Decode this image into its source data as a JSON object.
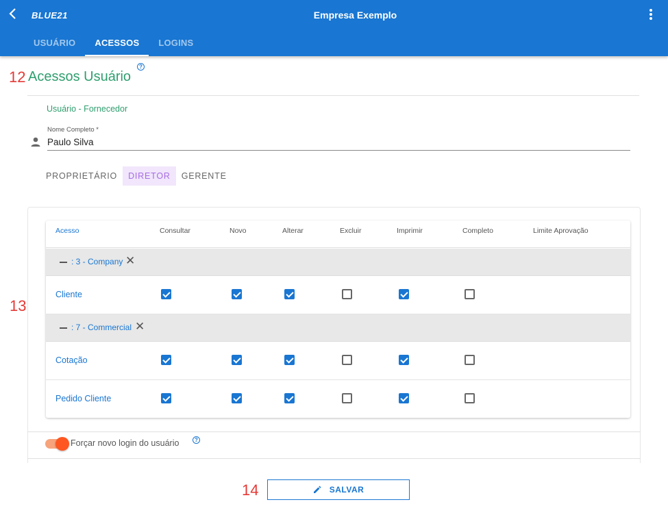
{
  "appbar": {
    "brand": "BLUE21",
    "title": "Empresa Exemplo",
    "tabs": [
      {
        "label": "USUÁRIO",
        "active": false
      },
      {
        "label": "ACESSOS",
        "active": true
      },
      {
        "label": "LOGINS",
        "active": false
      }
    ]
  },
  "steps": {
    "s12": "12",
    "s13": "13",
    "s14": "14"
  },
  "section": {
    "title": "Acessos Usuário",
    "help_icon": "?",
    "subtitle": "Usuário - Fornecedor"
  },
  "name_field": {
    "label": "Nome Completo *",
    "value": "Paulo Silva"
  },
  "roles": [
    {
      "label": "PROPRIETÁRIO",
      "active": false
    },
    {
      "label": "DIRETOR",
      "active": true
    },
    {
      "label": "GERENTE",
      "active": false
    }
  ],
  "table": {
    "headers": [
      "Acesso",
      "Consultar",
      "Novo",
      "Alterar",
      "Excluir",
      "Imprimir",
      "Completo",
      "Limite Aprovação"
    ],
    "groups": [
      {
        "label": ": 3 - Company",
        "rows": [
          {
            "label": "Cliente",
            "checks": [
              true,
              true,
              true,
              false,
              true,
              false
            ]
          }
        ]
      },
      {
        "label": ": 7 - Commercial",
        "rows": [
          {
            "label": "Cotação",
            "checks": [
              true,
              true,
              true,
              false,
              true,
              false
            ]
          },
          {
            "label": "Pedido Cliente",
            "checks": [
              true,
              true,
              true,
              false,
              true,
              false
            ]
          }
        ]
      }
    ]
  },
  "force_login": {
    "label": "Forçar novo login do usuário",
    "enabled": true
  },
  "save_button": {
    "label": "SALVAR"
  },
  "colors": {
    "primary": "#1976d2",
    "accent_green": "#2e9e6e",
    "step_red": "#e53935",
    "toggle_orange": "#ff5722",
    "role_active_bg": "#f1e6fb",
    "role_active_text": "#a66ce4"
  }
}
